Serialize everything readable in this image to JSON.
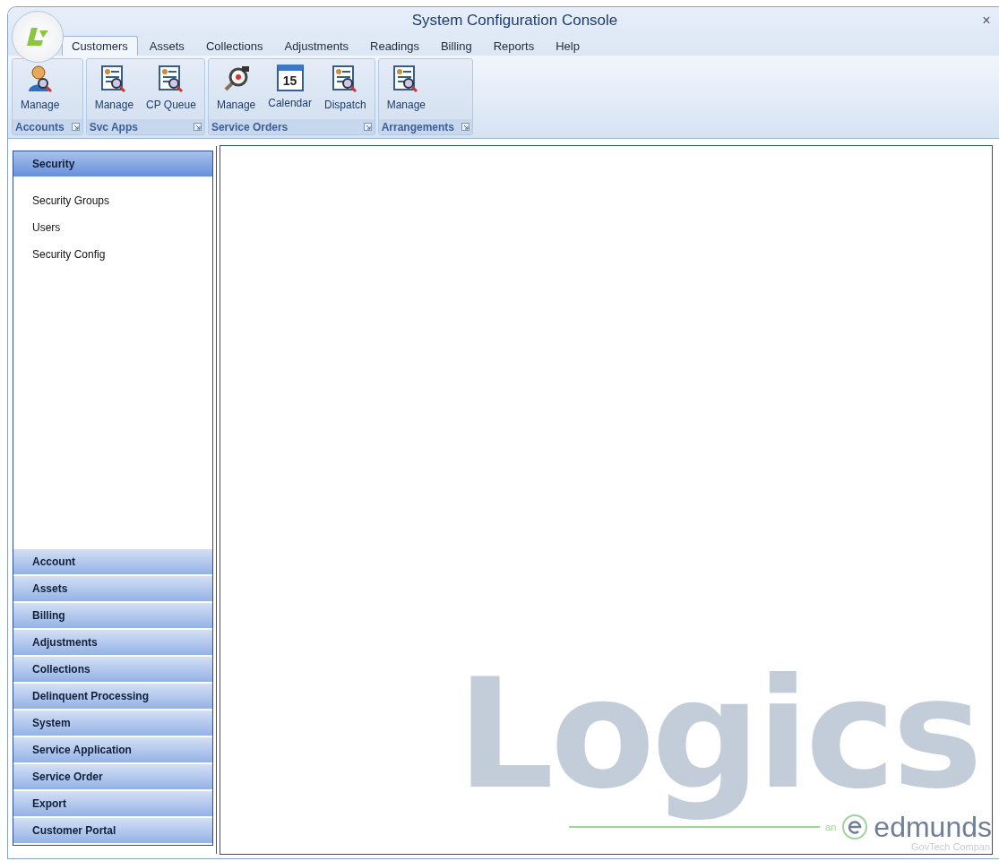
{
  "window": {
    "title": "System Configuration Console",
    "close": "×"
  },
  "tabs": [
    {
      "label": "Customers",
      "selected": true
    },
    {
      "label": "Assets",
      "selected": false
    },
    {
      "label": "Collections",
      "selected": false
    },
    {
      "label": "Adjustments",
      "selected": false
    },
    {
      "label": "Readings",
      "selected": false
    },
    {
      "label": "Billing",
      "selected": false
    },
    {
      "label": "Reports",
      "selected": false
    },
    {
      "label": "Help",
      "selected": false
    }
  ],
  "ribbon_groups": [
    {
      "label": "Accounts",
      "buttons": [
        {
          "label": "Manage",
          "kind": "person"
        }
      ]
    },
    {
      "label": "Svc Apps",
      "buttons": [
        {
          "label": "Manage",
          "kind": "form"
        },
        {
          "label": "CP Queue",
          "kind": "form"
        }
      ]
    },
    {
      "label": "Service Orders",
      "buttons": [
        {
          "label": "Manage",
          "kind": "meter"
        },
        {
          "label": "Calendar",
          "kind": "calendar",
          "day": "15"
        },
        {
          "label": "Dispatch",
          "kind": "form"
        }
      ]
    },
    {
      "label": "Arrangements",
      "buttons": [
        {
          "label": "Manage",
          "kind": "form"
        }
      ]
    }
  ],
  "sidebar": {
    "sections": [
      {
        "label": "Security",
        "expanded": true,
        "items": [
          "Security Groups",
          "Users",
          "Security Config"
        ]
      },
      {
        "label": "Account",
        "expanded": false
      },
      {
        "label": "Assets",
        "expanded": false
      },
      {
        "label": "Billing",
        "expanded": false
      },
      {
        "label": "Adjustments",
        "expanded": false
      },
      {
        "label": "Collections",
        "expanded": false
      },
      {
        "label": "Delinquent Processing",
        "expanded": false
      },
      {
        "label": "System",
        "expanded": false
      },
      {
        "label": "Service Application",
        "expanded": false
      },
      {
        "label": "Service Order",
        "expanded": false
      },
      {
        "label": "Export",
        "expanded": false
      },
      {
        "label": "Customer Portal",
        "expanded": false
      }
    ]
  },
  "brand": {
    "name": "Logics",
    "prefix": "an",
    "company": "edmunds",
    "tagline": "GovTech Compan"
  }
}
